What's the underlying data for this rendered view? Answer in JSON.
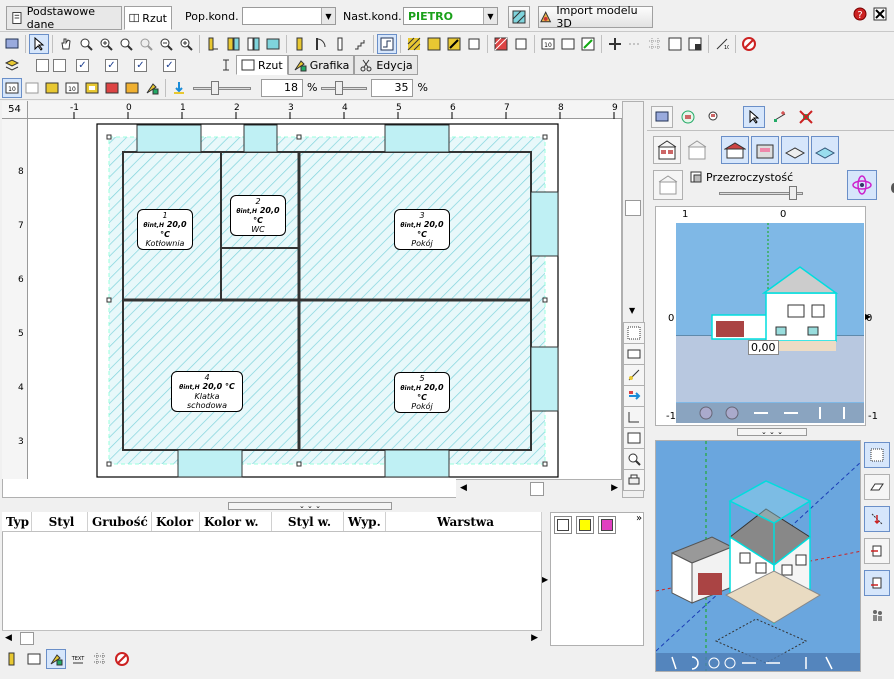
{
  "tabs": [
    {
      "label": "Podstawowe dane"
    },
    {
      "label": "Rzut"
    }
  ],
  "pop_kond": {
    "label": "Pop.kond.",
    "value": ""
  },
  "nast_kond": {
    "label": "Nast.kond.",
    "value": "PIETRO"
  },
  "import_button": "Import modelu 3D",
  "view_tabs": {
    "rzut": "Rzut",
    "grafika": "Grafika",
    "edycja": "Edycja"
  },
  "sliders": {
    "slider1_value": "18",
    "slider1_unit": "%",
    "slider2_value": "35",
    "slider2_unit": "%"
  },
  "ruler": {
    "corner": "54",
    "h_ticks": [
      "-1",
      "0",
      "1",
      "2",
      "3",
      "4",
      "5",
      "6",
      "7",
      "8",
      "9"
    ],
    "v_ticks": [
      "8",
      "7",
      "6",
      "5",
      "4",
      "3"
    ]
  },
  "rooms": [
    {
      "num": "1",
      "temp": "20,0 °C",
      "name": "Kotłownia"
    },
    {
      "num": "2",
      "temp": "20,0 °C",
      "name": "WC"
    },
    {
      "num": "3",
      "temp": "20,0 °C",
      "name": "Pokój"
    },
    {
      "num": "4",
      "temp": "20,0 °C",
      "name": "Klatka schodowa"
    },
    {
      "num": "5",
      "temp": "20,0 °C",
      "name": "Pokój"
    }
  ],
  "room_temp_prefix": "θint,H",
  "layer_table": {
    "columns": [
      "Typ",
      "Styl",
      "Grubość",
      "Kolor",
      "Kolor w.",
      "Styl w.",
      "Wyp.",
      "Warstwa"
    ]
  },
  "right_panel": {
    "transparency_label": "Przezroczystość",
    "preview_ticks_top": [
      "1",
      "0"
    ],
    "preview_ticks_side": [
      "0",
      "-1"
    ],
    "elevation_label": "0,00"
  },
  "colors": {
    "hatch": "#7fd4dc",
    "hatch_bg": "#dff5f7",
    "sky": "#7fb8e6",
    "accent_green": "#1aa01a"
  }
}
